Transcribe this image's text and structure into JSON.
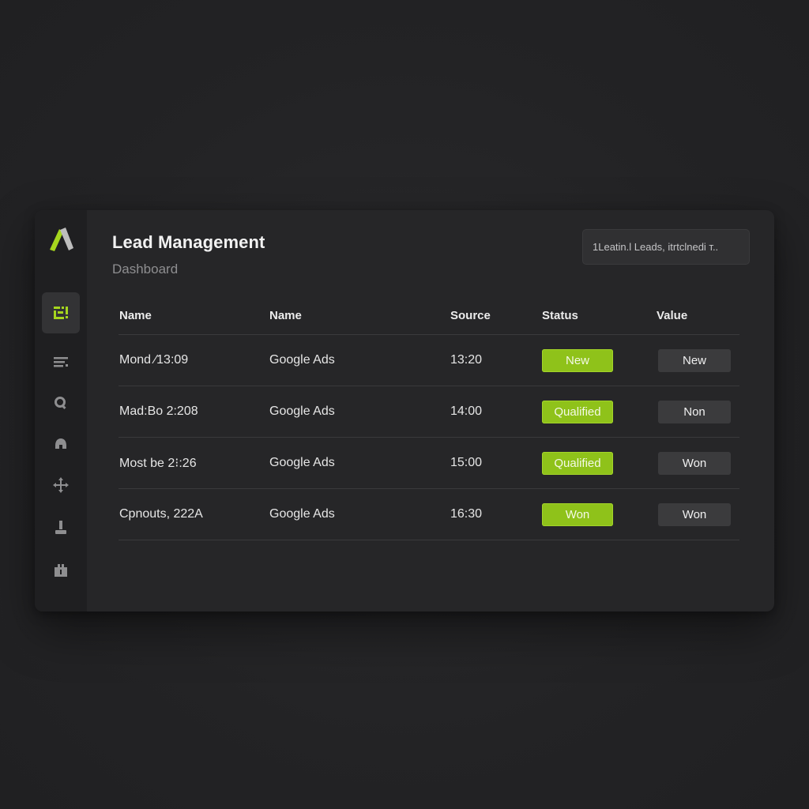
{
  "header": {
    "title": "Lead Management",
    "subtitle": "Dashboard"
  },
  "search": {
    "text": "1Leatin.l Leads, itrtclnedi т.."
  },
  "sidebar": {
    "logo": "app-logo",
    "items": [
      {
        "icon": "leads-board-icon",
        "active": true
      },
      {
        "icon": "list-icon",
        "active": false
      },
      {
        "icon": "search-icon",
        "active": false
      },
      {
        "icon": "headset-icon",
        "active": false
      },
      {
        "icon": "move-arrows-icon",
        "active": false
      },
      {
        "icon": "download-icon",
        "active": false
      },
      {
        "icon": "briefcase-icon",
        "active": false
      }
    ]
  },
  "table": {
    "columns": [
      "Name",
      "Name",
      "Source",
      "Status",
      "Value"
    ],
    "rows": [
      {
        "name": "Mond ⁄13:09",
        "contact": "Google Ads",
        "source": "13:20",
        "status": "New",
        "value": "New"
      },
      {
        "name": "Mad:Bo 2:208",
        "contact": "Google Ads",
        "source": "14:00",
        "status": "Qualified",
        "value": "Non"
      },
      {
        "name": "Most be 2⁝:26",
        "contact": "Google Ads",
        "source": "15:00",
        "status": "Qualified",
        "value": "Won"
      },
      {
        "name": "Cpnouts, 222A",
        "contact": "Google Ads",
        "source": "16:30",
        "status": "Won",
        "value": "Won"
      }
    ]
  },
  "colors": {
    "accent": "#8fc21a",
    "background": "#232325",
    "card": "#262628",
    "sidebar": "#1f1f21"
  }
}
